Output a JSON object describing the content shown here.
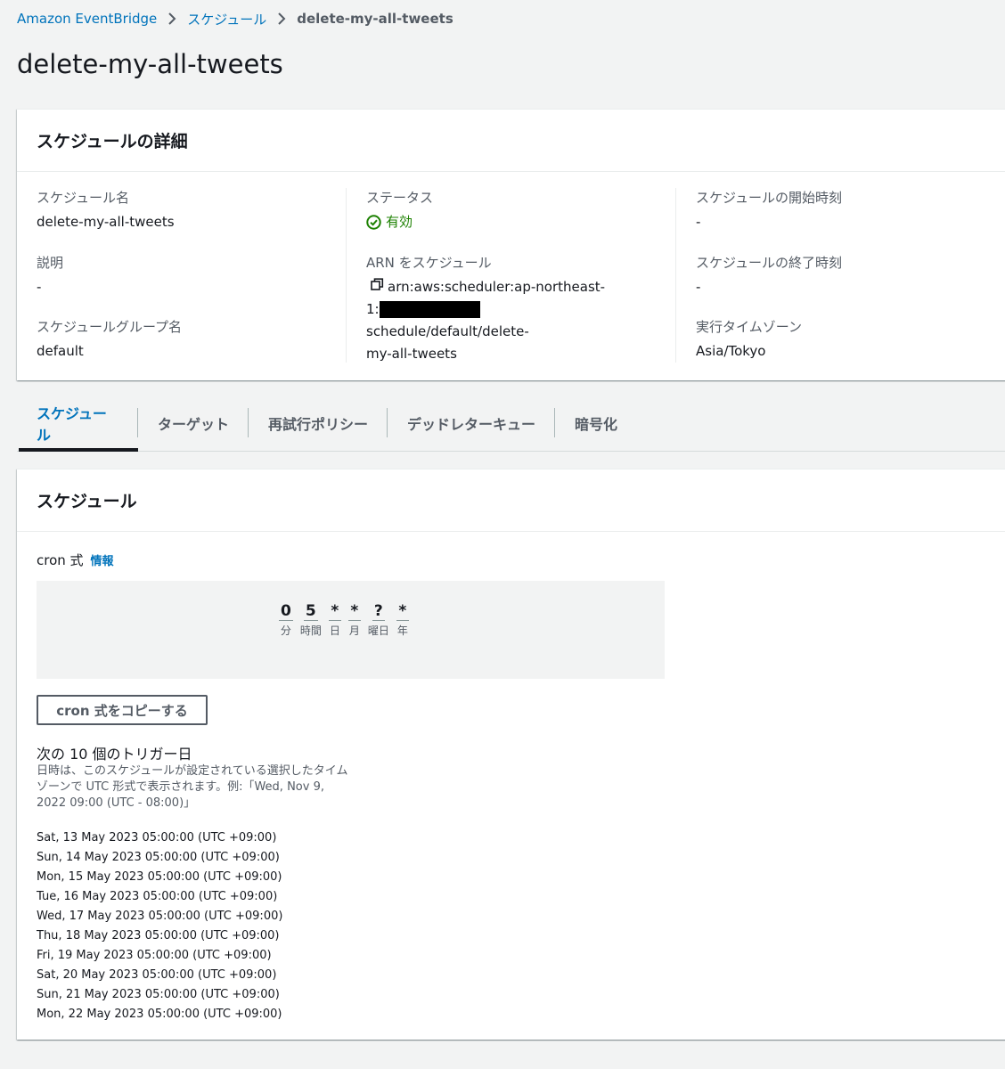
{
  "breadcrumb": {
    "items": [
      "Amazon EventBridge",
      "スケジュール"
    ],
    "current": "delete-my-all-tweets"
  },
  "page": {
    "title": "delete-my-all-tweets"
  },
  "details": {
    "header": "スケジュールの詳細",
    "schedule_name": {
      "label": "スケジュール名",
      "value": "delete-my-all-tweets"
    },
    "description": {
      "label": "説明",
      "value": "-"
    },
    "group": {
      "label": "スケジュールグループ名",
      "value": "default"
    },
    "status": {
      "label": "ステータス",
      "value": "有効",
      "color": "#1d8102"
    },
    "arn": {
      "label": "ARN をスケジュール",
      "line1": "arn:aws:scheduler:ap-northeast-",
      "prefix": "1:",
      "suffix": "schedule/default/delete-",
      "line3": "my-all-tweets"
    },
    "start_time": {
      "label": "スケジュールの開始時刻",
      "value": "-"
    },
    "end_time": {
      "label": "スケジュールの終了時刻",
      "value": "-"
    },
    "timezone": {
      "label": "実行タイムゾーン",
      "value": "Asia/Tokyo"
    }
  },
  "tabs": [
    {
      "label": "スケジュール",
      "active": true
    },
    {
      "label": "ターゲット"
    },
    {
      "label": "再試行ポリシー"
    },
    {
      "label": "デッドレターキュー"
    },
    {
      "label": "暗号化"
    }
  ],
  "schedule": {
    "header": "スケジュール",
    "cron_label": "cron 式",
    "info_link": "情報",
    "cron_fields": [
      {
        "value": "0",
        "unit": "分"
      },
      {
        "value": "5",
        "unit": "時間"
      },
      {
        "value": "*",
        "unit": "日"
      },
      {
        "value": "*",
        "unit": "月"
      },
      {
        "value": "?",
        "unit": "曜日"
      },
      {
        "value": "*",
        "unit": "年"
      }
    ],
    "copy_button": "cron 式をコピーする",
    "triggers_title": "次の 10 個のトリガー日",
    "triggers_description": "日時は、このスケジュールが設定されている選択したタイムゾーンで UTC 形式で表示されます。例:「Wed, Nov 9, 2022 09:00 (UTC - 08:00)」",
    "triggers": [
      "Sat, 13 May 2023 05:00:00 (UTC +09:00)",
      "Sun, 14 May 2023 05:00:00 (UTC +09:00)",
      "Mon, 15 May 2023 05:00:00 (UTC +09:00)",
      "Tue, 16 May 2023 05:00:00 (UTC +09:00)",
      "Wed, 17 May 2023 05:00:00 (UTC +09:00)",
      "Thu, 18 May 2023 05:00:00 (UTC +09:00)",
      "Fri, 19 May 2023 05:00:00 (UTC +09:00)",
      "Sat, 20 May 2023 05:00:00 (UTC +09:00)",
      "Sun, 21 May 2023 05:00:00 (UTC +09:00)",
      "Mon, 22 May 2023 05:00:00 (UTC +09:00)"
    ]
  },
  "colors": {
    "link": "#0073bb",
    "success": "#1d8102",
    "text": "#16191f",
    "muted": "#545b64"
  },
  "icons": [
    "chevron-right-icon",
    "status-check-icon",
    "copy-icon"
  ]
}
